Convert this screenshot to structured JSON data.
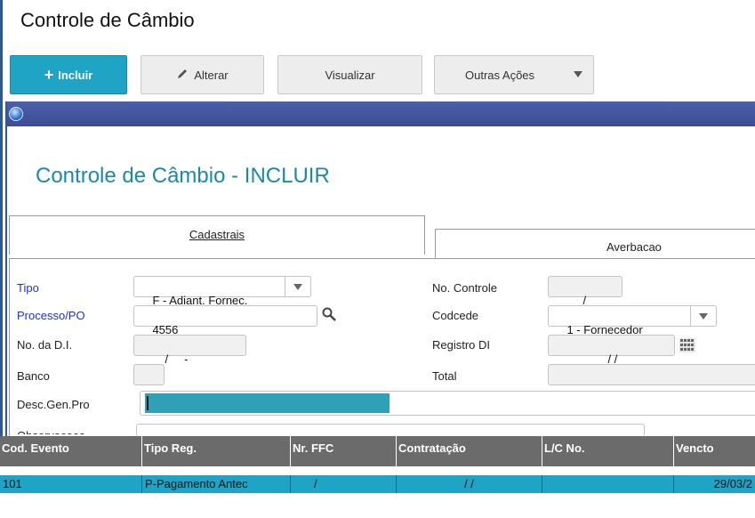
{
  "app": {
    "title": "Controle de Câmbio"
  },
  "toolbar": {
    "incluir": "Incluir",
    "alterar": "Alterar",
    "visualizar": "Visualizar",
    "outras": "Outras Ações"
  },
  "dialog": {
    "title": "Controle de Câmbio - INCLUIR",
    "tabs": [
      {
        "label": "Cadastrais"
      },
      {
        "label": "Averbacao"
      }
    ]
  },
  "form": {
    "tipo": {
      "label": "Tipo",
      "value": "F - Adiant. Fornec."
    },
    "processo": {
      "label": "Processo/PO",
      "value": "4556"
    },
    "di": {
      "label": "No. da D.I.",
      "value": "/     -"
    },
    "banco": {
      "label": "Banco",
      "value": ""
    },
    "desc": {
      "label": "Desc.Gen.Pro",
      "value": ""
    },
    "obs": {
      "label": "Observacoes"
    },
    "controle": {
      "label": "No. Controle",
      "value": "/"
    },
    "codcede": {
      "label": "Codcede",
      "value": "1 - Fornecedor"
    },
    "registro": {
      "label": "Registro DI",
      "value": "/ /"
    },
    "total": {
      "label": "Total",
      "value": ""
    }
  },
  "grid": {
    "columns": [
      "Cod. Evento",
      "Tipo Reg.",
      "Nr. FFC",
      "Contratação",
      "L/C No.",
      "Vencto"
    ],
    "rows": [
      {
        "cod": "101",
        "tipo": "P-Pagamento Antec",
        "ffc": "/",
        "contratacao": "/ /",
        "lc": "",
        "vencto": "29/03/2"
      }
    ]
  },
  "colors": {
    "accent": "#1fa4c6",
    "dialog_bar": "#4c5fa8",
    "title": "#1b8aa8",
    "required": "#1f2fd8"
  }
}
